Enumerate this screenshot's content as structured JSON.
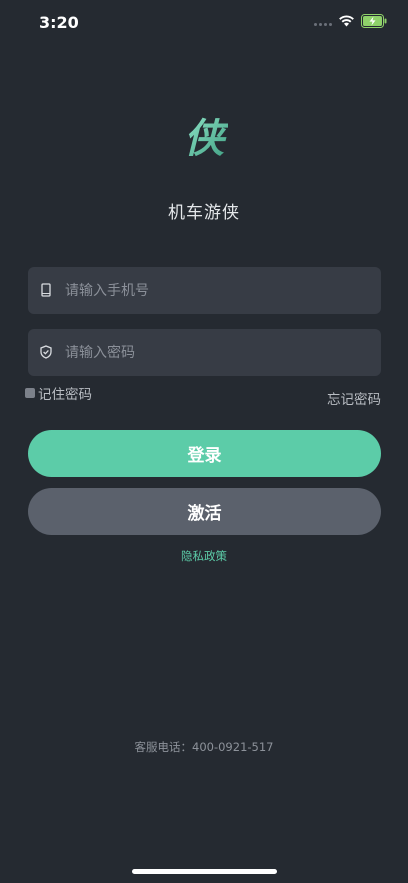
{
  "status_bar": {
    "time": "3:20"
  },
  "app": {
    "logo_text": "侠",
    "name": "机车游侠"
  },
  "login_form": {
    "phone_placeholder": "请输入手机号",
    "password_placeholder": "请输入密码",
    "remember_label": "记住密码",
    "forgot_label": "忘记密码",
    "login_button": "登录",
    "activate_button": "激活",
    "privacy_link": "隐私政策"
  },
  "footer": {
    "hotline": "客服电话：400-0921-517"
  },
  "colors": {
    "background": "#252a31",
    "accent": "#5ccca8",
    "field_bg": "#373c45",
    "secondary_button": "#5b616c"
  }
}
